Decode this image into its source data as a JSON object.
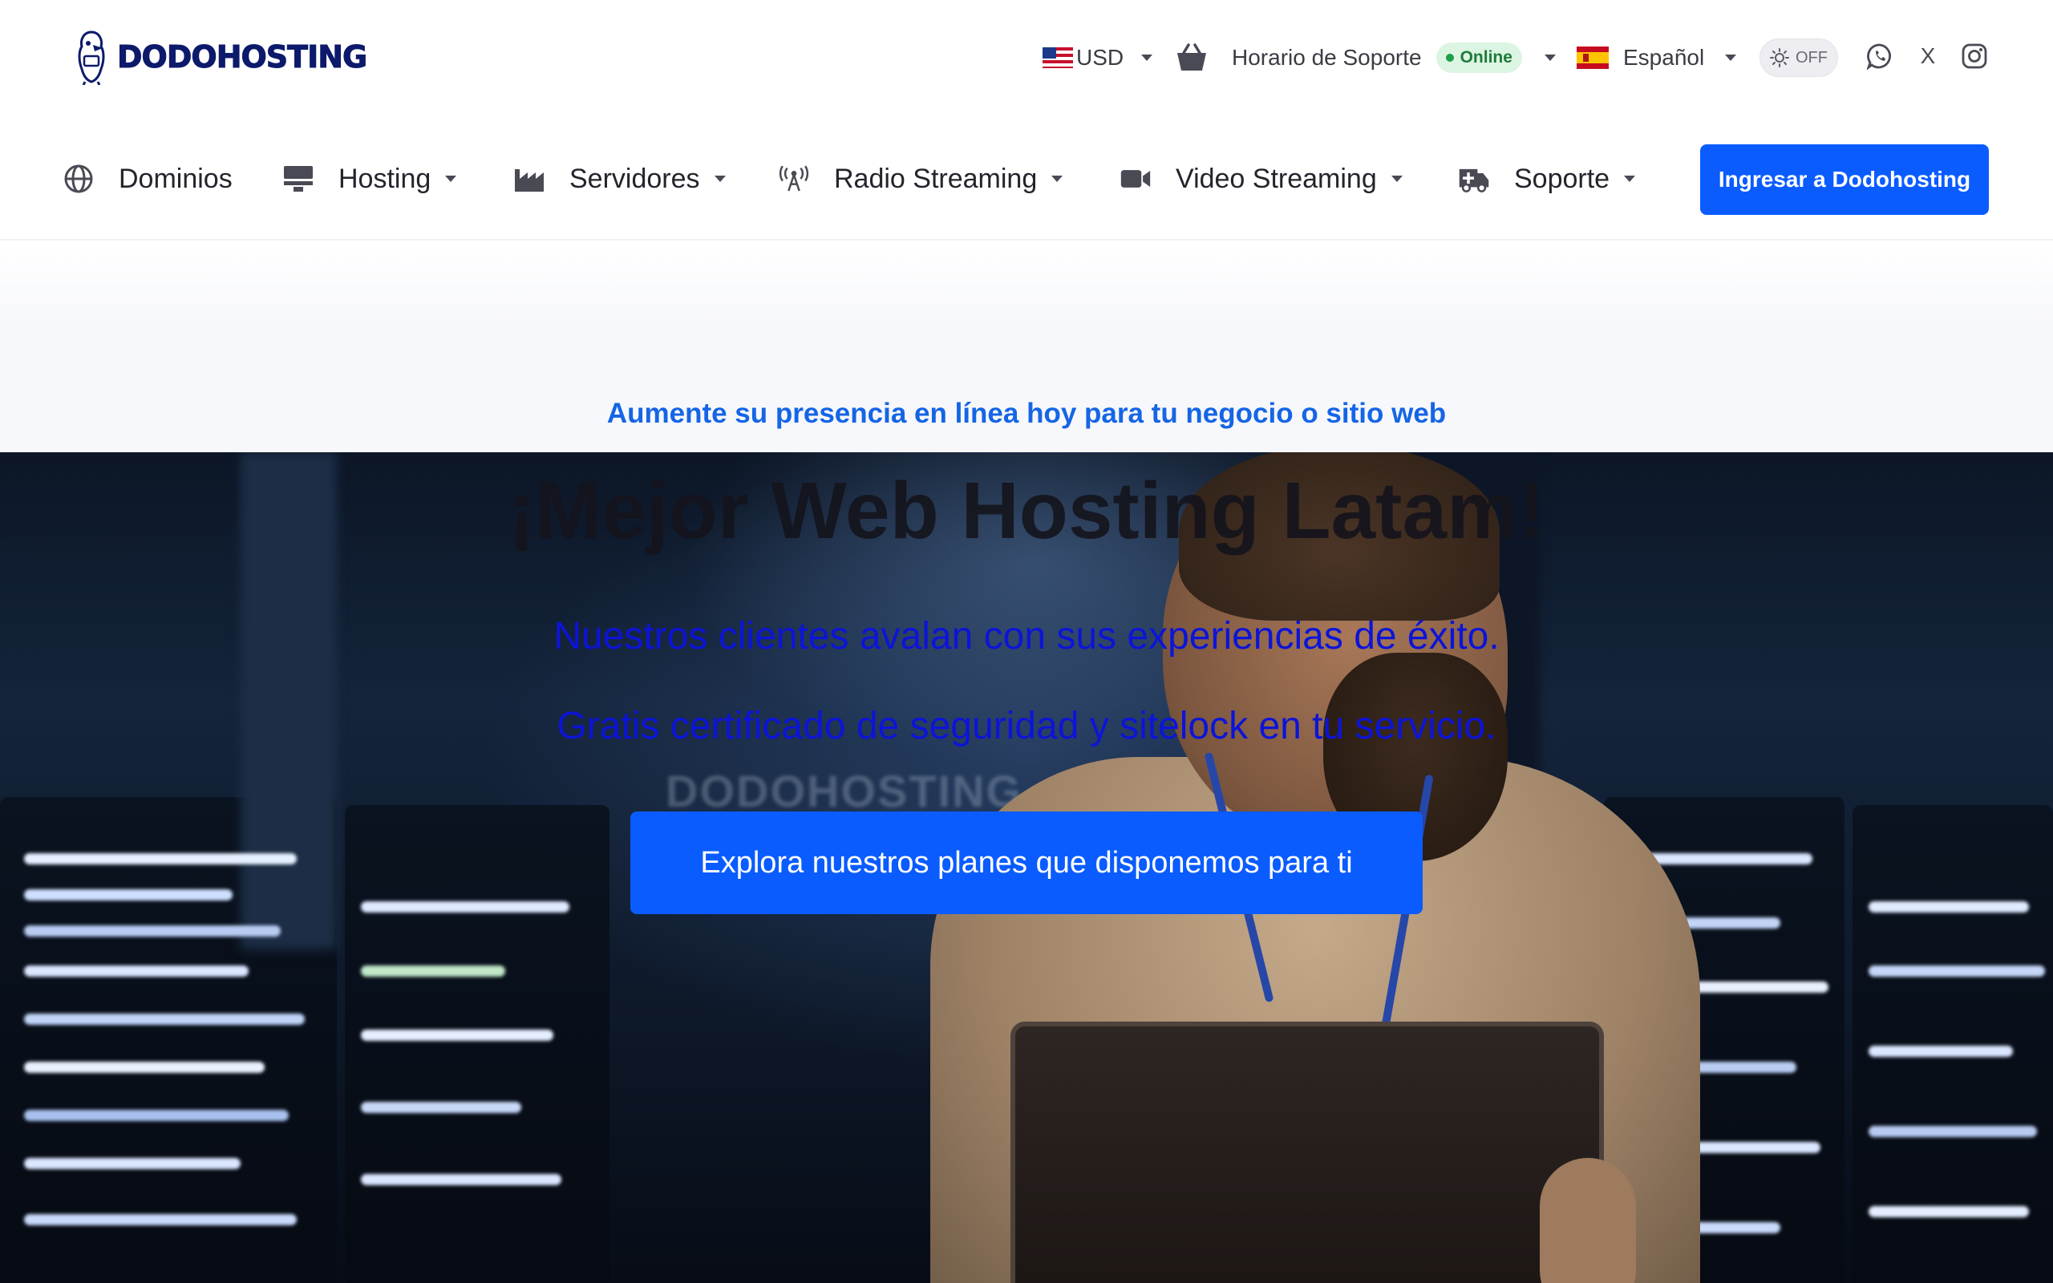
{
  "brand": {
    "name": "DODOHOSTING"
  },
  "topbar": {
    "currency": {
      "label": "USD",
      "flag": "us-flag-icon"
    },
    "support": {
      "label": "Horario de Soporte",
      "status": "Online",
      "status_color": "#1f9d4a"
    },
    "language": {
      "label": "Español",
      "flag": "es-flag-icon"
    },
    "dark_mode": {
      "state": "OFF"
    },
    "social": [
      {
        "name": "whatsapp-icon"
      },
      {
        "name": "x-icon",
        "label": "X"
      },
      {
        "name": "instagram-icon"
      }
    ]
  },
  "nav": {
    "items": [
      {
        "label": "Dominios",
        "icon": "globe-icon",
        "has_dropdown": false
      },
      {
        "label": "Hosting",
        "icon": "server-rack-icon",
        "has_dropdown": true
      },
      {
        "label": "Servidores",
        "icon": "industry-icon",
        "has_dropdown": true
      },
      {
        "label": "Radio Streaming",
        "icon": "broadcast-tower-icon",
        "has_dropdown": true
      },
      {
        "label": "Video Streaming",
        "icon": "video-camera-icon",
        "has_dropdown": true
      },
      {
        "label": "Soporte",
        "icon": "ambulance-icon",
        "has_dropdown": true
      }
    ],
    "cta_label": "Ingresar a Dodohosting"
  },
  "hero": {
    "tagline": "Aumente su presencia en línea hoy para tu negocio o sitio web",
    "title": "¡Mejor Web Hosting Latam!",
    "lines": [
      "Nuestros clientes avalan con sus experiencias de éxito.",
      "Gratis certificado de seguridad y sitelock en tu servicio."
    ],
    "cta_label": "Explora nuestros planes que disponemos para ti",
    "photo_watermark": "DODOHOSTING"
  },
  "colors": {
    "accent": "#0a5cff",
    "tagline": "#1565e6",
    "hero_lines": "#0c14d8",
    "brand_dark": "#0d1a6b"
  }
}
